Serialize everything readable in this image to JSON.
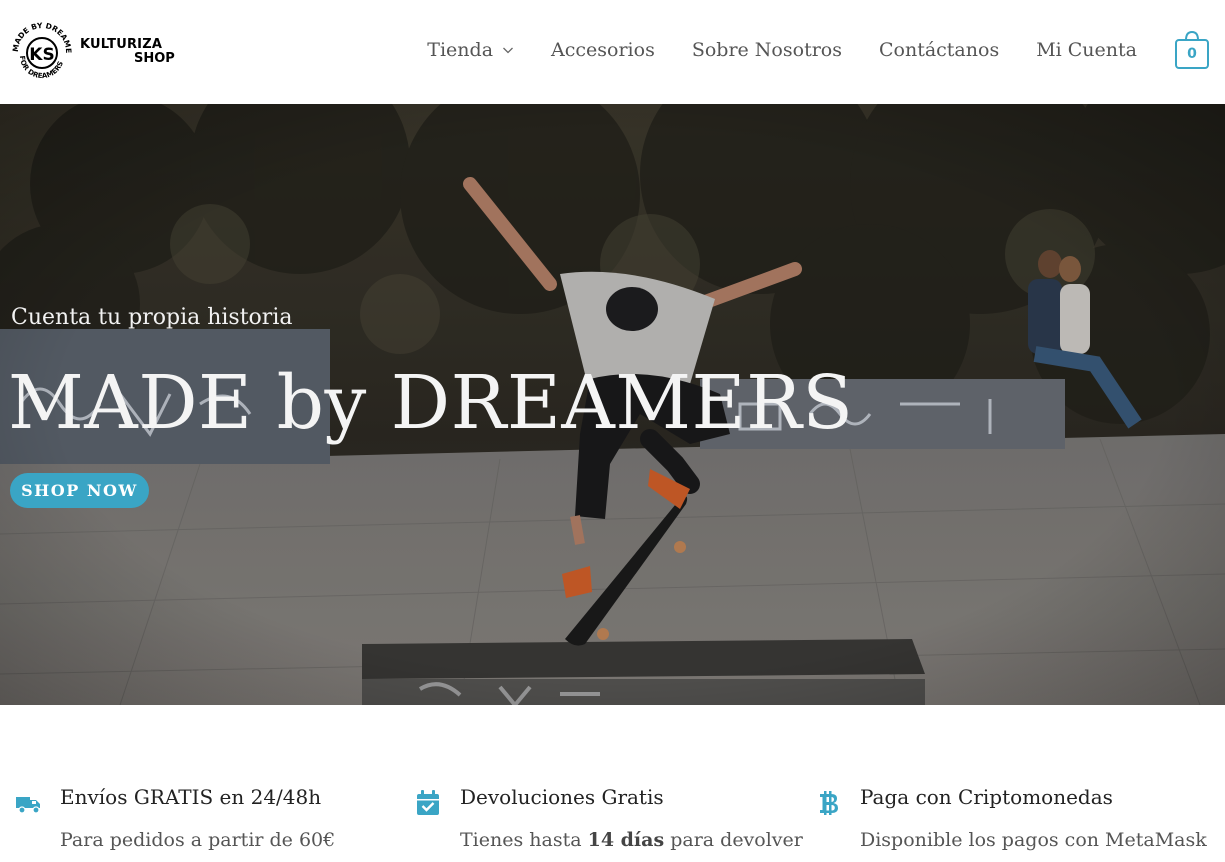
{
  "brand": {
    "badge_text": "MADE BY DREAMERS · FOR DREAMERS",
    "badge_initials": "KS",
    "name_line1": "KULTURIZA",
    "name_line2": "SHOP"
  },
  "nav": {
    "items": [
      {
        "label": "Tienda",
        "has_dropdown": true
      },
      {
        "label": "Accesorios"
      },
      {
        "label": "Sobre Nosotros"
      },
      {
        "label": "Contáctanos"
      },
      {
        "label": "Mi Cuenta"
      }
    ],
    "cart_count": "0"
  },
  "hero": {
    "subtitle": "Cuenta tu propia historia",
    "title": "MADE by DREAMERS",
    "button_label": "SHOP NOW"
  },
  "features": [
    {
      "icon": "truck-icon",
      "title": "Envíos GRATIS en 24/48h",
      "desc": "Para pedidos a partir de 60€"
    },
    {
      "icon": "calendar-check-icon",
      "title": "Devoluciones Gratis",
      "desc_prefix": "Tienes hasta ",
      "desc_bold": "14 días",
      "desc_suffix": " para devolver"
    },
    {
      "icon": "bitcoin-icon",
      "title": "Paga con Criptomonedas",
      "desc": "Disponible los pagos con MetaMask"
    }
  ],
  "colors": {
    "accent": "#3aa5c5",
    "text": "#3a3a3a"
  }
}
